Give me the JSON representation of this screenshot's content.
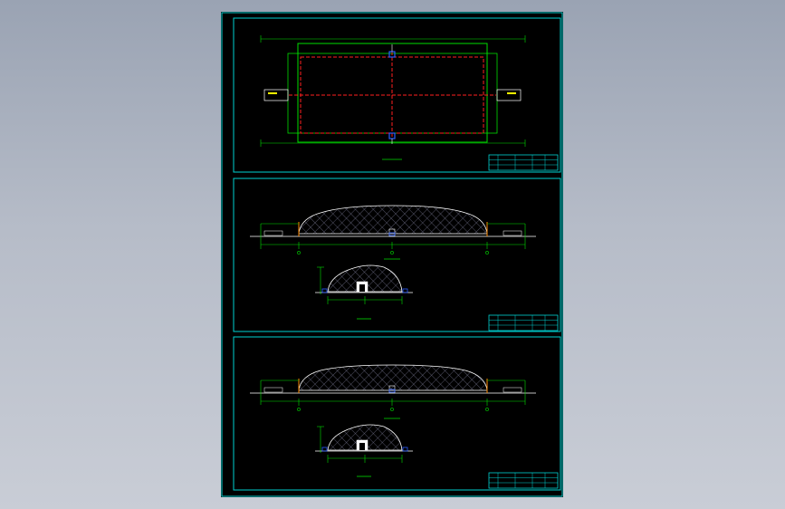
{
  "viewport": {
    "background_color": "#a6aebd"
  },
  "drawing": {
    "background_color": "#000000",
    "frame_color": "#00d2d2",
    "colors": {
      "cyan": "#00d2d2",
      "green": "#00dd00",
      "red": "#ff2020",
      "white": "#ffffff",
      "yellow": "#ffff00",
      "blue": "#2a5cff",
      "orange": "#ff8a00",
      "hatch": "#8a8aa8"
    },
    "sheets": [
      {
        "id": "plan",
        "kind": "plan-view"
      },
      {
        "id": "elevation-1",
        "kind": "section-view"
      },
      {
        "id": "elevation-2",
        "kind": "section-view"
      }
    ]
  }
}
